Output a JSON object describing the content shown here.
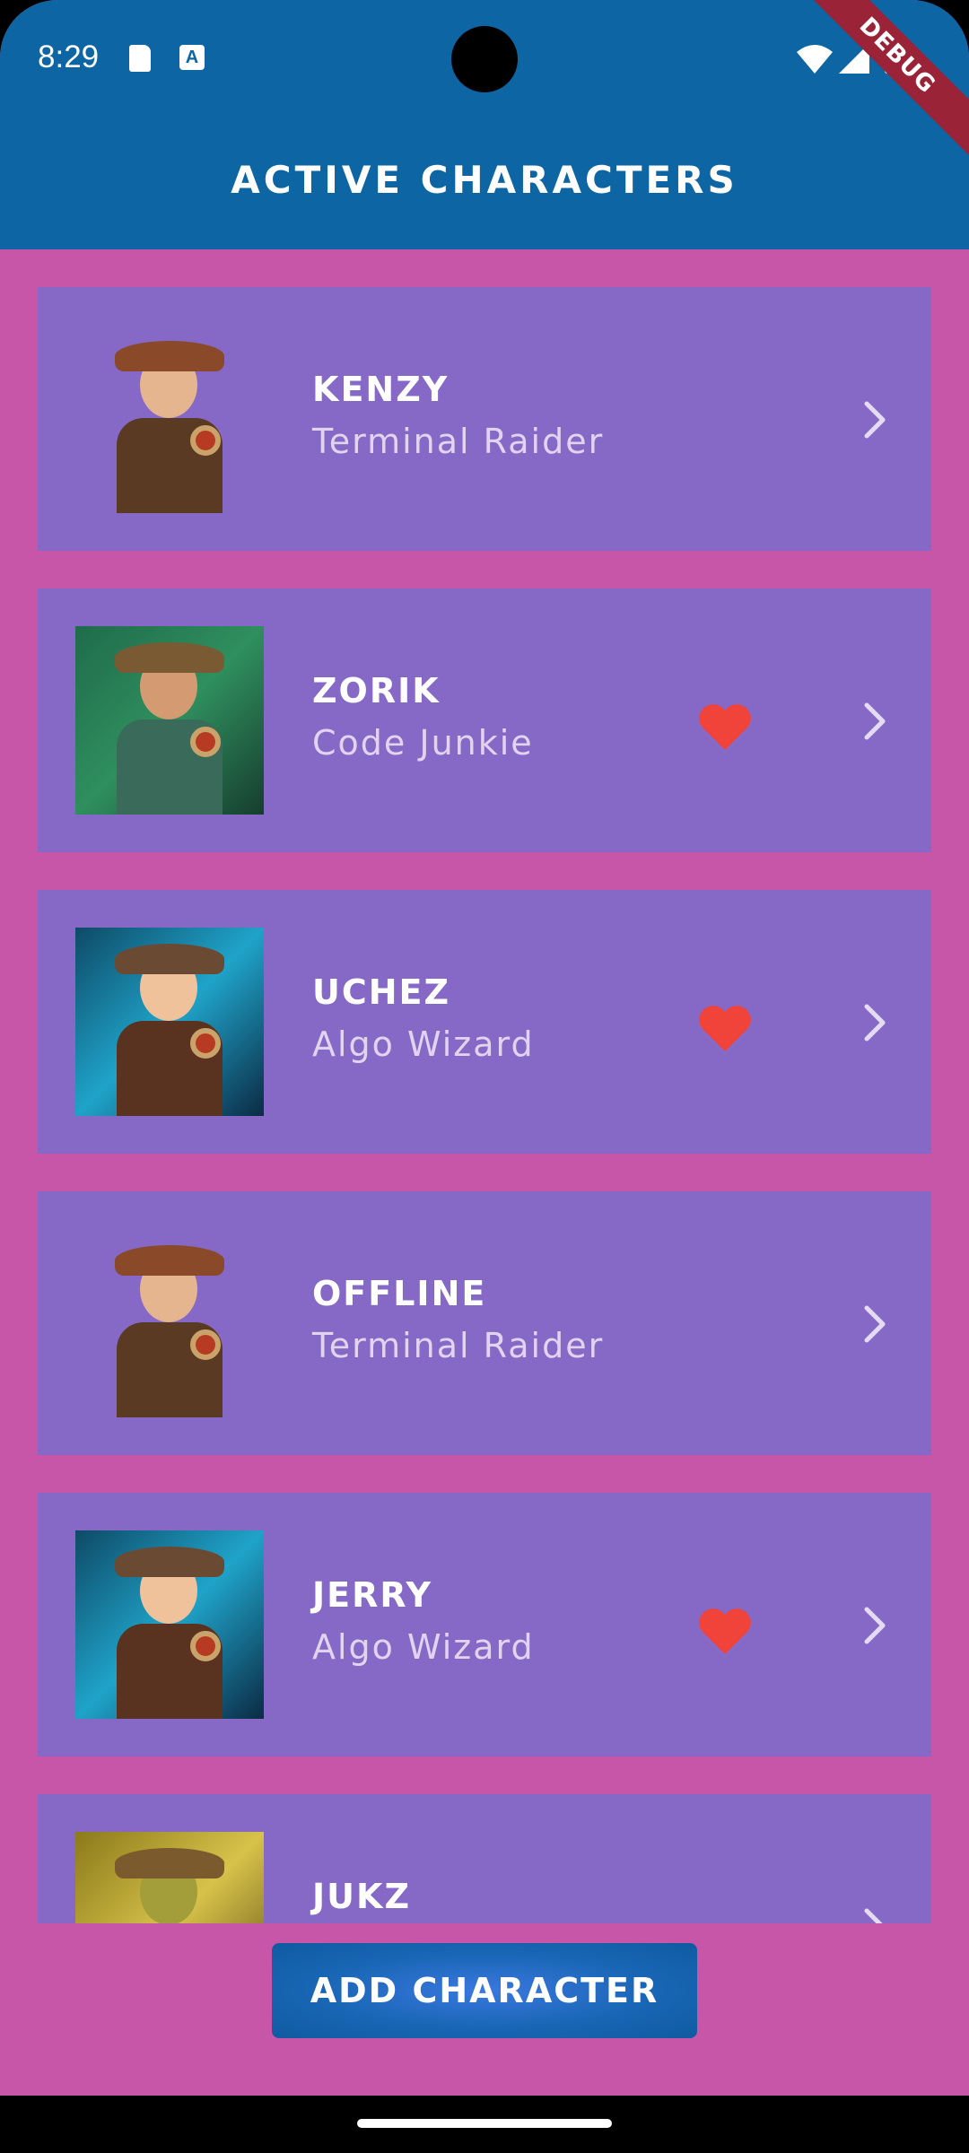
{
  "status_bar": {
    "time": "8:29",
    "a_icon_label": "A",
    "debug_label": "DEBUG"
  },
  "app_bar": {
    "title": "ACTIVE CHARACTERS"
  },
  "characters": [
    {
      "name": "KENZY",
      "role": "Terminal Raider",
      "favorite": false,
      "avatar": "steampunk-girl-avatar"
    },
    {
      "name": "ZORIK",
      "role": "Code Junkie",
      "favorite": true,
      "avatar": "bearded-man-pipe-avatar"
    },
    {
      "name": "UCHEZ",
      "role": "Algo Wizard",
      "favorite": true,
      "avatar": "wizard-girl-avatar"
    },
    {
      "name": "OFFLINE",
      "role": "Terminal Raider",
      "favorite": false,
      "avatar": "steampunk-girl-avatar"
    },
    {
      "name": "JERRY",
      "role": "Algo Wizard",
      "favorite": true,
      "avatar": "wizard-girl-avatar"
    },
    {
      "name": "JUKZ",
      "role": "",
      "favorite": false,
      "avatar": "goggles-goblin-avatar"
    }
  ],
  "add_button": {
    "label": "ADD CHARACTER"
  },
  "colors": {
    "app_bar": "#0d65a3",
    "background": "#c755a8",
    "card": "#8669c7",
    "heart": "#f0443a"
  }
}
